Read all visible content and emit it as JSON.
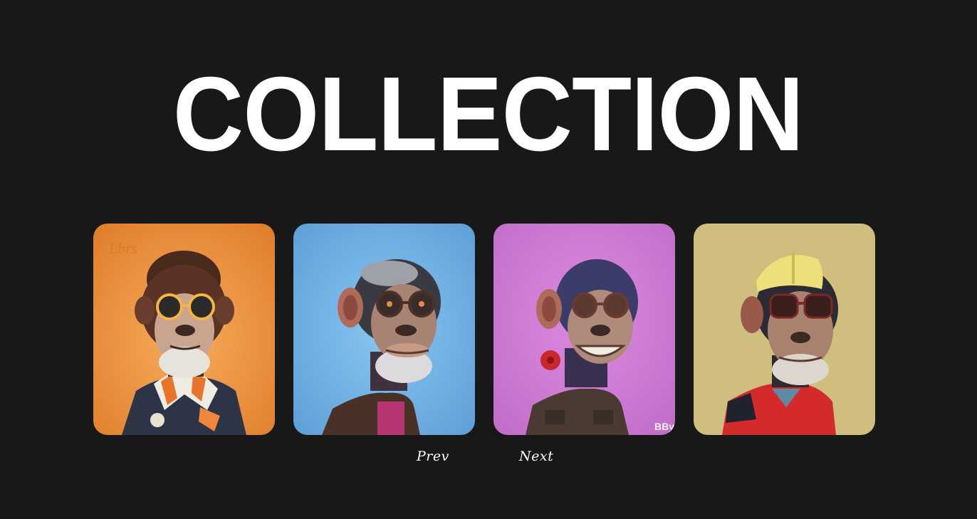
{
  "header": {
    "title": "COLLECTION"
  },
  "gallery": {
    "cards": [
      {
        "background": "#e98a35",
        "icon": "ape-with-glasses-orange-card"
      },
      {
        "background": "#6fb0e4",
        "icon": "ape-with-glasses-blue-card",
        "watermark": ""
      },
      {
        "background": "#d07ad6",
        "icon": "ape-smiling-purple-card",
        "watermark": "BBy"
      },
      {
        "background": "#d0bf80",
        "icon": "ape-with-cap-tan-card"
      }
    ]
  },
  "pagination": {
    "prev_label": "Prev",
    "next_label": "Next"
  },
  "colors": {
    "page_background": "#181818",
    "text": "#ffffff"
  }
}
